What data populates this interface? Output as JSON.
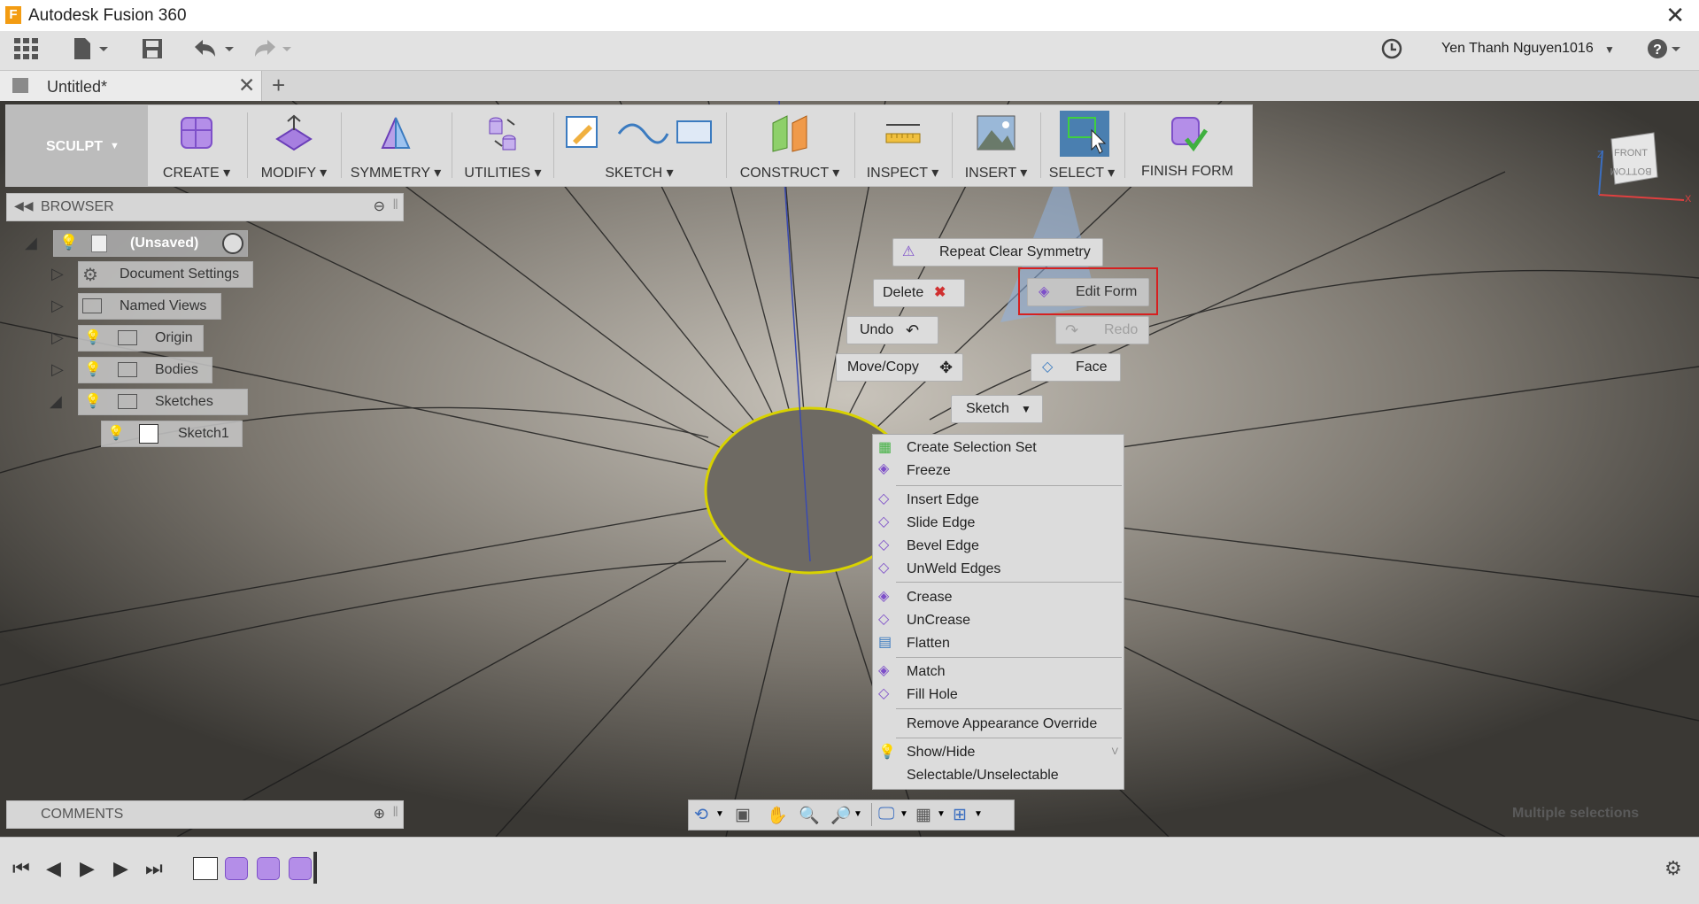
{
  "window": {
    "title": "Autodesk Fusion 360",
    "logo_letter": "F"
  },
  "header": {
    "user": "Yen Thanh Nguyen1016"
  },
  "tabs": {
    "active": "Untitled*"
  },
  "ribbon": {
    "workspace": "SCULPT",
    "groups": [
      {
        "label": "CREATE ▾"
      },
      {
        "label": "MODIFY ▾"
      },
      {
        "label": "SYMMETRY ▾"
      },
      {
        "label": "UTILITIES ▾"
      },
      {
        "label": "SKETCH ▾"
      },
      {
        "label": "CONSTRUCT ▾"
      },
      {
        "label": "INSPECT ▾"
      },
      {
        "label": "INSERT ▾"
      },
      {
        "label": "SELECT ▾"
      },
      {
        "label": "FINISH FORM"
      }
    ]
  },
  "browser": {
    "title": "BROWSER",
    "root": "(Unsaved)",
    "items": [
      "Document Settings",
      "Named Views",
      "Origin",
      "Bodies",
      "Sketches",
      "Sketch1"
    ]
  },
  "marking_menu": {
    "repeat": "Repeat Clear Symmetry",
    "delete": "Delete",
    "edit_form": "Edit Form",
    "undo": "Undo",
    "redo": "Redo",
    "move_copy": "Move/Copy",
    "face": "Face",
    "sketch": "Sketch"
  },
  "context_menu": {
    "items": [
      "Create Selection Set",
      "Freeze",
      "Insert Edge",
      "Slide Edge",
      "Bevel Edge",
      "UnWeld Edges",
      "Crease",
      "UnCrease",
      "Flatten",
      "Match",
      "Fill Hole",
      "Remove Appearance Override",
      "Show/Hide",
      "Selectable/Unselectable"
    ]
  },
  "comments": {
    "title": "COMMENTS"
  },
  "status": {
    "selection": "Multiple selections"
  },
  "viewcube": {
    "front": "FRONT",
    "bottom": "BOTTOM"
  },
  "colors": {
    "accent_highlight": "#d62020",
    "select_active": "#4a7fb0",
    "sculpt_purple": "#9b6fd8"
  }
}
